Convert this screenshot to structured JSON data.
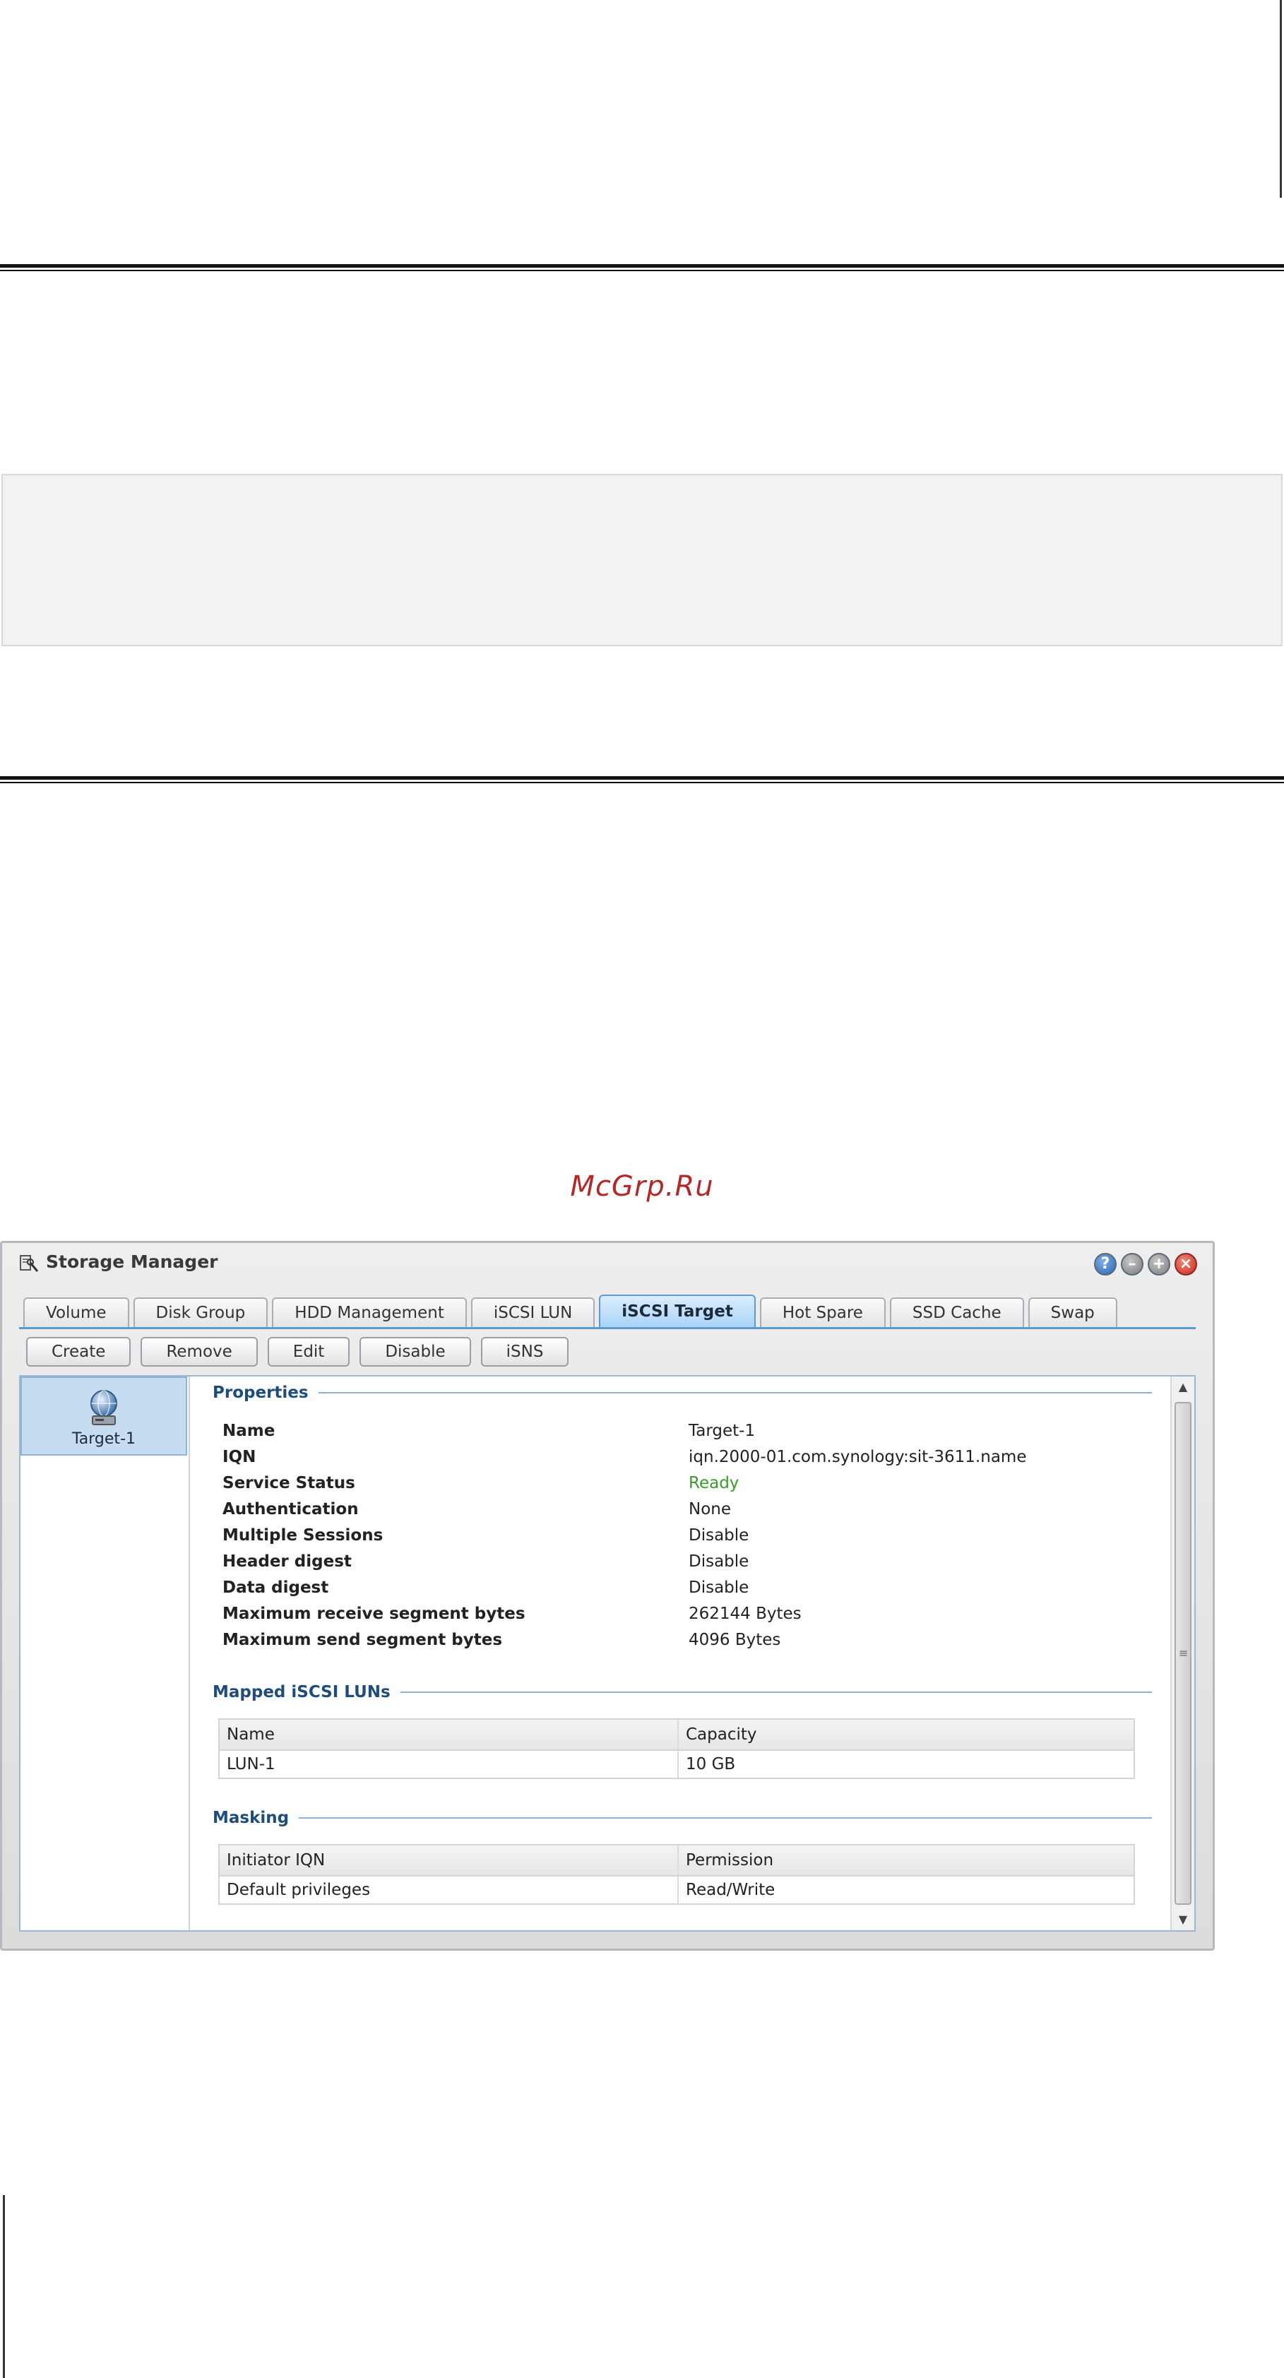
{
  "watermark": "McGrp.Ru",
  "window": {
    "title": "Storage Manager",
    "controls": {
      "help": "?",
      "minimize": "–",
      "maximize": "+",
      "close": "×"
    }
  },
  "tabs": [
    {
      "label": "Volume"
    },
    {
      "label": "Disk Group"
    },
    {
      "label": "HDD Management"
    },
    {
      "label": "iSCSI LUN"
    },
    {
      "label": "iSCSI Target",
      "active": true
    },
    {
      "label": "Hot Spare"
    },
    {
      "label": "SSD Cache"
    },
    {
      "label": "Swap"
    }
  ],
  "toolbar": {
    "create": "Create",
    "remove": "Remove",
    "edit": "Edit",
    "disable": "Disable",
    "isns": "iSNS"
  },
  "targets": [
    {
      "label": "Target-1",
      "icon": "globe-target-icon"
    }
  ],
  "properties": {
    "title": "Properties",
    "rows": [
      {
        "label": "Name",
        "value": "Target-1"
      },
      {
        "label": "IQN",
        "value": "iqn.2000-01.com.synology:sit-3611.name"
      },
      {
        "label": "Service Status",
        "value": "Ready",
        "value_color": "#3a9a2a"
      },
      {
        "label": "Authentication",
        "value": "None"
      },
      {
        "label": "Multiple Sessions",
        "value": "Disable"
      },
      {
        "label": "Header digest",
        "value": "Disable"
      },
      {
        "label": "Data digest",
        "value": "Disable"
      },
      {
        "label": "Maximum receive segment bytes",
        "value": "262144 Bytes"
      },
      {
        "label": "Maximum send segment bytes",
        "value": "4096 Bytes"
      }
    ]
  },
  "mapped_luns": {
    "title": "Mapped iSCSI LUNs",
    "columns": [
      "Name",
      "Capacity"
    ],
    "rows": [
      [
        "LUN-1",
        "10 GB"
      ]
    ]
  },
  "masking": {
    "title": "Masking",
    "columns": [
      "Initiator IQN",
      "Permission"
    ],
    "rows": [
      [
        "Default privileges",
        "Read/Write"
      ]
    ]
  },
  "colors": {
    "accent": "#5c9bd1",
    "section_title": "#1e4d7a",
    "status_ready": "#3a9a2a",
    "watermark": "#b02a2a"
  }
}
